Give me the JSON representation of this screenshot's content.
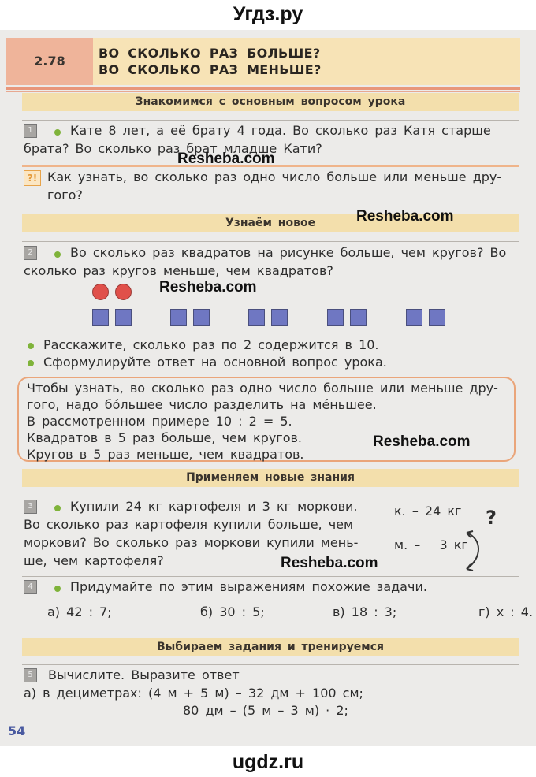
{
  "site": {
    "top_label": "Угдз.ру",
    "bottom_label": "ugdz.ru"
  },
  "header": {
    "lesson_number": "2.78",
    "title_line1": "ВО СКОЛЬКО РАЗ БОЛЬШЕ?",
    "title_line2": "ВО СКОЛЬКО РАЗ МЕНЬШЕ?"
  },
  "sections": {
    "intro": "Знакомимся с основным вопросом урока",
    "new": "Узнаём новое",
    "apply": "Применяем новые знания",
    "practice": "Выбираем задания и тренируемся"
  },
  "watermark": "Resheba.com",
  "task1": {
    "number": "1",
    "line1": "Кате 8 лет, а её брату 4 года. Во сколько раз Катя старше",
    "line2": "брата? Во сколько раз брат младше Кати?"
  },
  "problem": {
    "icon": "?!",
    "line1": "Как узнать, во сколько раз одно число больше или меньше дру-",
    "line2": "гого?"
  },
  "task2": {
    "number": "2",
    "line1": "Во сколько раз квадратов на рисунке больше, чем кругов? Во",
    "line2": "сколько раз кругов меньше, чем квадратов?",
    "circles_count": 2,
    "squares_groups": 5,
    "squares_per_group": 2,
    "bullet1": "Расскажите, сколько раз по 2 содержится в 10.",
    "bullet2": "Сформулируйте ответ на основной вопрос урока."
  },
  "rule": {
    "line1": "Чтобы узнать, во сколько раз одно число больше или меньше дру-",
    "line2": "гого, надо бóльшее число разделить на мéньшее.",
    "line3": "В рассмотренном примере 10 : 2 = 5.",
    "line4": "Квадратов в 5 раз больше, чем кругов.",
    "line5": "Кругов в 5 раз меньше, чем квадратов."
  },
  "task3": {
    "number": "3",
    "line1": "Купили 24 кг картофеля и 3 кг моркови.",
    "line2": "Во сколько раз картофеля купили больше, чем",
    "line3": "моркови? Во сколько раз моркови купили мень-",
    "line4": "ше, чем картофеля?",
    "scheme_top": "к. – 24 кг",
    "scheme_bottom": "м. –   3 кг",
    "scheme_question": "?"
  },
  "task4": {
    "number": "4",
    "text": "Придумайте по этим выражениям похожие задачи.",
    "items": [
      "а) 42 : 7;",
      "б) 30 : 5;",
      "в) 18 : 3;",
      "г) x : 4."
    ]
  },
  "task5": {
    "number": "5",
    "text": "Вычислите. Выразите ответ",
    "line1": "а) в дециметрах: (4 м + 5 м) – 32 дм + 100 см;",
    "line2": "80 дм – (5 м – 3 м) · 2;"
  },
  "page_number": "54"
}
